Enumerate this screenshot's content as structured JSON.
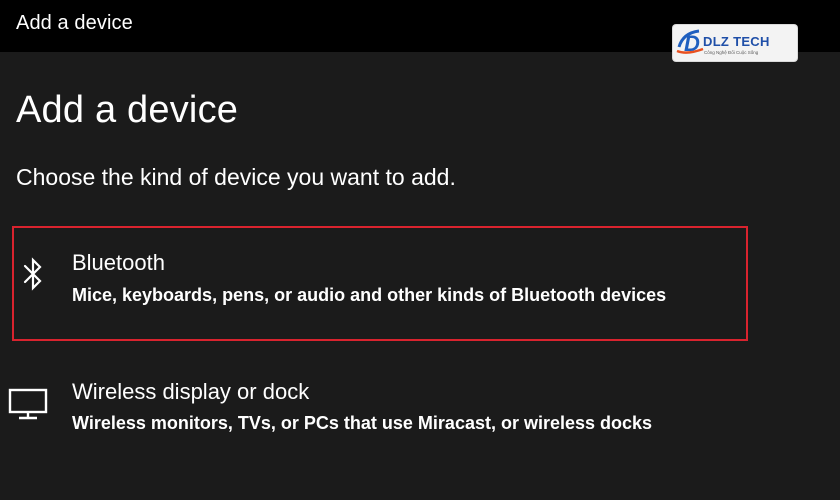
{
  "window": {
    "title": "Add a device"
  },
  "watermark": {
    "brand": "DLZ TECH",
    "tagline": "Công Nghệ Đổi Cuộc Sống"
  },
  "page": {
    "heading": "Add a device",
    "subtitle": "Choose the kind of device you want to add."
  },
  "options": [
    {
      "title": "Bluetooth",
      "description": "Mice, keyboards, pens, or audio and other kinds of Bluetooth devices",
      "icon": "bluetooth-icon",
      "highlighted": true
    },
    {
      "title": "Wireless display or dock",
      "description": "Wireless monitors, TVs, or PCs that use Miracast, or wireless docks",
      "icon": "monitor-icon",
      "highlighted": false
    }
  ],
  "colors": {
    "background": "#1b1b1b",
    "titlebar": "#000000",
    "text": "#ffffff",
    "highlight_border": "#d9232e"
  }
}
